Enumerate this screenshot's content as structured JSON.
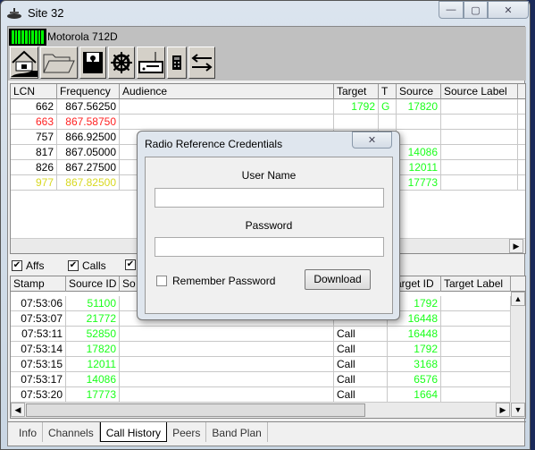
{
  "window": {
    "title": "Site 32",
    "minimize": "—",
    "maximize": "▢",
    "close": "✕"
  },
  "status": {
    "radio": "Motorola 712D",
    "signal_level": 1.0
  },
  "toolbar": [
    {
      "icon": "home-icon"
    },
    {
      "icon": "folder-open-icon"
    },
    {
      "icon": "save-icon"
    },
    {
      "icon": "wheel-icon"
    },
    {
      "icon": "scanner-icon"
    },
    {
      "icon": "calculator-icon"
    },
    {
      "icon": "swap-arrows-icon"
    }
  ],
  "channels": {
    "columns": [
      "LCN",
      "Frequency",
      "Audience",
      "Target",
      "T",
      "Source",
      "Source Label"
    ],
    "rows": [
      {
        "lcn": "662",
        "freq": "867.56250",
        "target": "1792",
        "t": "G",
        "source": "17820",
        "color": "black"
      },
      {
        "lcn": "663",
        "freq": "867.58750",
        "target": "",
        "t": "",
        "source": "",
        "color": "red"
      },
      {
        "lcn": "757",
        "freq": "866.92500",
        "target": "",
        "t": "",
        "source": "",
        "color": "black"
      },
      {
        "lcn": "817",
        "freq": "867.05000",
        "target": "",
        "t": "",
        "source": "14086",
        "color": "black"
      },
      {
        "lcn": "826",
        "freq": "867.27500",
        "target": "",
        "t": "",
        "source": "12011",
        "color": "black"
      },
      {
        "lcn": "977",
        "freq": "867.82500",
        "target": "",
        "t": "",
        "source": "17773",
        "color": "yellow"
      }
    ]
  },
  "filters": [
    {
      "label": "Affs",
      "checked": true
    },
    {
      "label": "Calls",
      "checked": true
    },
    {
      "label": "",
      "checked": true
    }
  ],
  "history": {
    "columns": [
      "Stamp",
      "Source ID",
      "So",
      "",
      "Target ID",
      "Target Label"
    ],
    "rows": [
      {
        "stamp": "07:53:06",
        "src": "51100",
        "type": "",
        "tgt": "1792"
      },
      {
        "stamp": "07:53:07",
        "src": "21772",
        "type": "",
        "tgt": "16448"
      },
      {
        "stamp": "07:53:11",
        "src": "52850",
        "type": "Call",
        "tgt": "16448"
      },
      {
        "stamp": "07:53:14",
        "src": "17820",
        "type": "Call",
        "tgt": "1792"
      },
      {
        "stamp": "07:53:15",
        "src": "12011",
        "type": "Call",
        "tgt": "3168"
      },
      {
        "stamp": "07:53:17",
        "src": "14086",
        "type": "Call",
        "tgt": "6576"
      },
      {
        "stamp": "07:53:20",
        "src": "17773",
        "type": "Call",
        "tgt": "1664"
      }
    ]
  },
  "tabs": [
    {
      "label": "Info"
    },
    {
      "label": "Channels"
    },
    {
      "label": "Call History",
      "active": true
    },
    {
      "label": "Peers"
    },
    {
      "label": "Band Plan"
    }
  ],
  "dialog": {
    "title": "Radio Reference Credentials",
    "close": "✕",
    "username_label": "User Name",
    "username_value": "",
    "password_label": "Password",
    "password_value": "",
    "remember_label": "Remember Password",
    "remember_checked": false,
    "download_label": "Download"
  }
}
